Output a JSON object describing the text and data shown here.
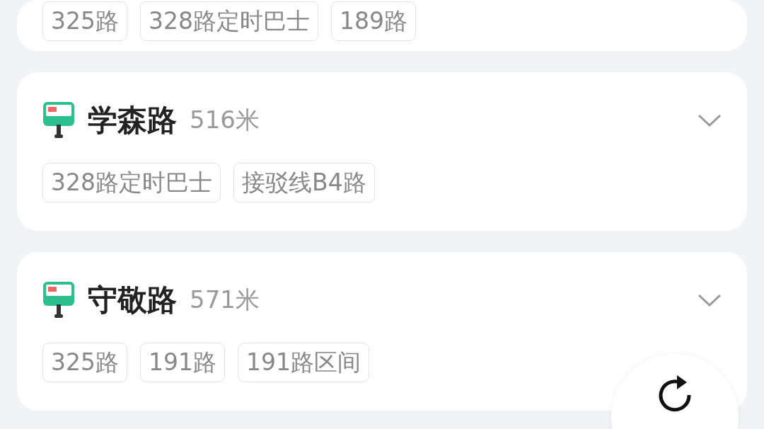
{
  "stops": [
    {
      "routes": [
        "325路",
        "328路定时巴士",
        "189路"
      ]
    },
    {
      "name": "学森路",
      "distance": "516米",
      "expanded": false,
      "routes": [
        "328路定时巴士",
        "接驳线B4路"
      ]
    },
    {
      "name": "守敬路",
      "distance": "571米",
      "expanded": false,
      "routes": [
        "325路",
        "191路",
        "191路区间"
      ]
    }
  ]
}
